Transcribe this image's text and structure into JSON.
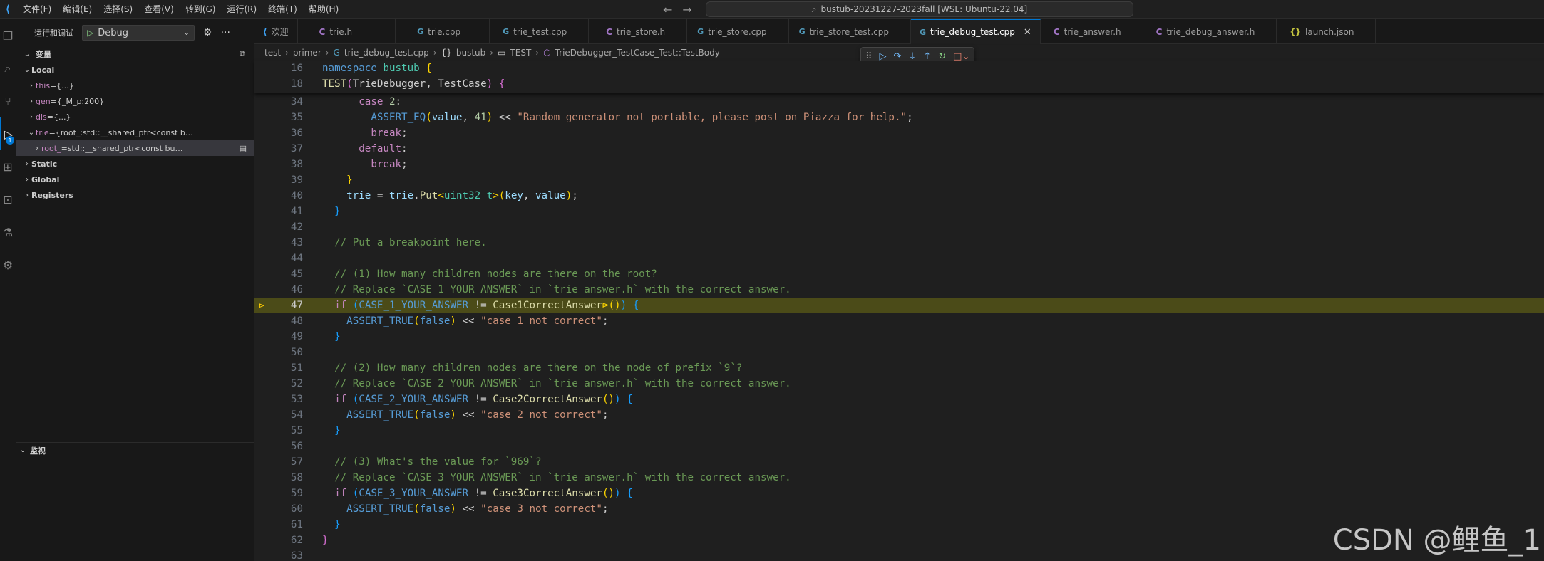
{
  "titlebar": {
    "menu": [
      "文件(F)",
      "编辑(E)",
      "选择(S)",
      "查看(V)",
      "转到(G)",
      "运行(R)",
      "终端(T)",
      "帮助(H)"
    ],
    "search_text": "bustub-20231227-2023fall [WSL: Ubuntu-22.04]"
  },
  "sidebar": {
    "title": "运行和调试",
    "config": "Debug",
    "variables_header": "变量",
    "local_label": "Local",
    "vars": [
      {
        "name": "this",
        "value": "{...}"
      },
      {
        "name": "gen",
        "value": "{_M_p:200}"
      },
      {
        "name": "dis",
        "value": "{...}"
      },
      {
        "name": "trie",
        "value": "{root_:std::__shared_ptr<const b…"
      },
      {
        "name": "root_",
        "value": "std::__shared_ptr<const bu…"
      }
    ],
    "scopes": [
      "Static",
      "Global",
      "Registers"
    ],
    "watch_header": "监视"
  },
  "tabs": [
    {
      "label": "欢迎",
      "icon": "vscode-icon"
    },
    {
      "label": "trie.h",
      "icon": "c-icon"
    },
    {
      "label": "trie.cpp",
      "icon": "cpp-icon"
    },
    {
      "label": "trie_test.cpp",
      "icon": "cpp-icon"
    },
    {
      "label": "trie_store.h",
      "icon": "c-icon"
    },
    {
      "label": "trie_store.cpp",
      "icon": "cpp-icon"
    },
    {
      "label": "trie_store_test.cpp",
      "icon": "cpp-icon"
    },
    {
      "label": "trie_debug_test.cpp",
      "icon": "cpp-icon",
      "active": true
    },
    {
      "label": "trie_answer.h",
      "icon": "c-icon"
    },
    {
      "label": "trie_debug_answer.h",
      "icon": "c-icon"
    },
    {
      "label": "launch.json",
      "icon": "json-icon"
    }
  ],
  "breadcrumb": [
    "test",
    "primer",
    "trie_debug_test.cpp",
    "bustub",
    "TEST",
    "TrieDebugger_TestCase_Test::TestBody"
  ],
  "editor": {
    "current_line": 47,
    "sticky_lines": [
      16,
      18
    ],
    "line_numbers": [
      16,
      18,
      34,
      35,
      36,
      37,
      38,
      39,
      40,
      41,
      42,
      43,
      44,
      45,
      46,
      47,
      48,
      49,
      50,
      51,
      52,
      53,
      54,
      55,
      56,
      57,
      58,
      59,
      60,
      61,
      62,
      63
    ]
  },
  "watermark": "CSDN @鲤鱼_1"
}
